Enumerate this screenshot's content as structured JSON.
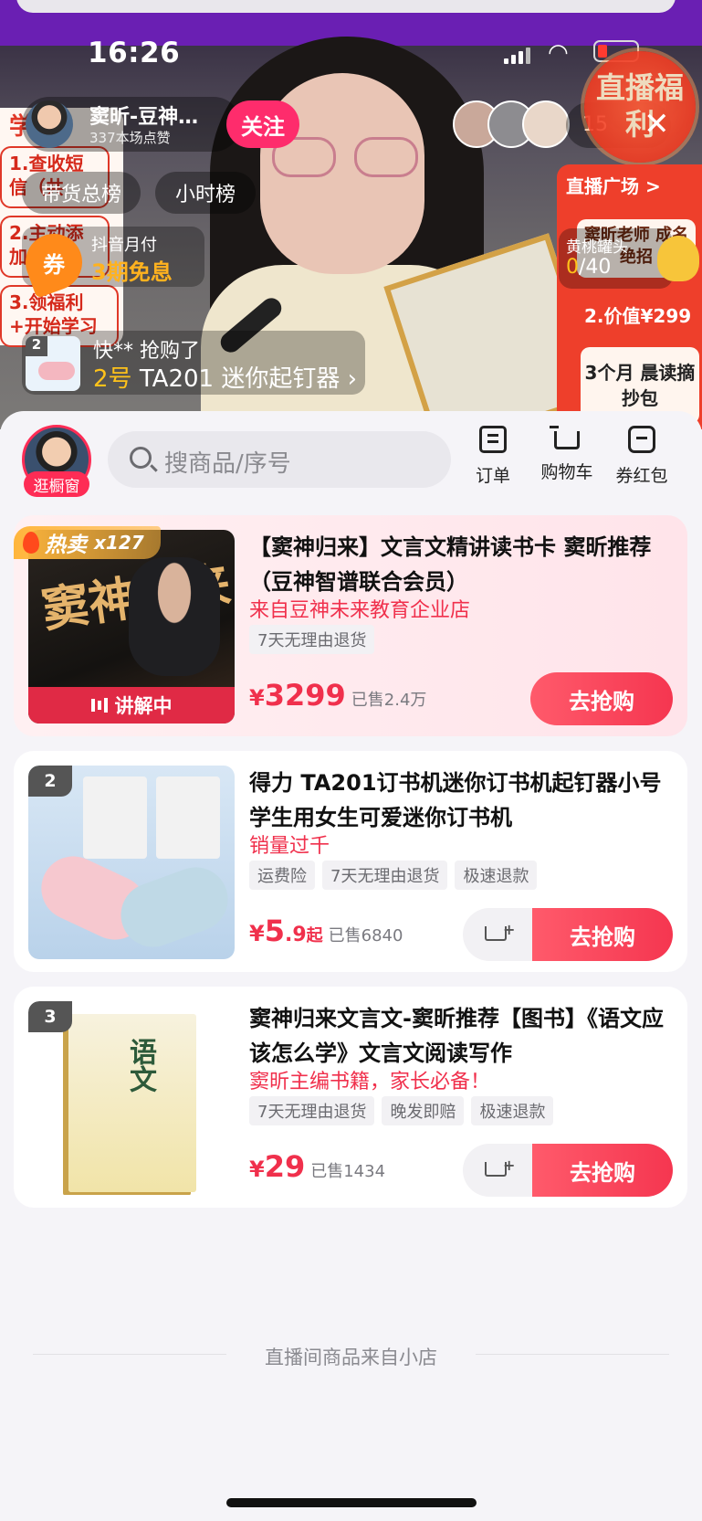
{
  "status_bar": {
    "time": "16:26"
  },
  "live": {
    "anchor_name": "窦昕-豆神…",
    "anchor_likes": "337本场点赞",
    "follow_label": "关注",
    "viewer_count": "15",
    "rank_total": "带货总榜",
    "rank_hour": "小时榜",
    "welfare_badge": "直播福利",
    "left_card": {
      "top": "学",
      "step1": "1.查收短信（共",
      "step2": "2.主动添加",
      "step3": "3.领福利+开始学习"
    },
    "installment": {
      "title": "抖音月付",
      "subtitle": "3期免息",
      "icon_text": "券"
    },
    "right_panel": {
      "head": "直播广场 >",
      "card1": "窦昕老师 成名绝招",
      "mid": "2.价值¥299",
      "card2": "3个月 晨读摘抄包"
    },
    "peach": {
      "title": "黄桃罐头",
      "count_now": "0",
      "count_total": "/40"
    },
    "purchase": {
      "who": "快** 抢购了",
      "rank": "2号",
      "item": "TA201 迷你起钉器 ›",
      "thumb_rank": "2"
    }
  },
  "sheet": {
    "shop_tag": "逛橱窗",
    "search_placeholder": "搜商品/序号",
    "tools": {
      "order": "订单",
      "cart": "购物车",
      "wallet": "券红包"
    },
    "products": [
      {
        "hot_label": "热卖",
        "hot_count": "x127",
        "explaining": "讲解中",
        "title": "【窦神归来】文言文精讲读书卡 窦昕推荐（豆神智谱联合会员）",
        "subtitle": "来自豆神未来教育企业店",
        "tags": [
          "7天无理由退货"
        ],
        "price_symbol": "¥",
        "price": "3299",
        "sold": "已售2.4万",
        "buy_label": "去抢购",
        "thumb_text": "窦神归来"
      },
      {
        "rank": "2",
        "title": "得力 TA201订书机迷你订书机起钉器小号学生用女生可爱迷你订书机",
        "subtitle": "销量过千",
        "tags": [
          "运费险",
          "7天无理由退货",
          "极速退款"
        ],
        "price_symbol": "¥",
        "price": "5",
        "price_decimal": ".9",
        "price_suffix": "起",
        "sold": "已售6840",
        "buy_label": "去抢购"
      },
      {
        "rank": "3",
        "title": "窦神归来文言文-窦昕推荐【图书】《语文应该怎么学》文言文阅读写作",
        "subtitle": "窦昕主编书籍，家长必备！",
        "tags": [
          "7天无理由退货",
          "晚发即赔",
          "极速退款"
        ],
        "price_symbol": "¥",
        "price": "29",
        "sold": "已售1434",
        "buy_label": "去抢购",
        "book_title": "语文"
      }
    ],
    "footer": "直播间商品来自小店"
  },
  "colors": {
    "accent": "#f0304c",
    "follow": "#fe2c6c",
    "live_top": "#6a1fb3"
  }
}
